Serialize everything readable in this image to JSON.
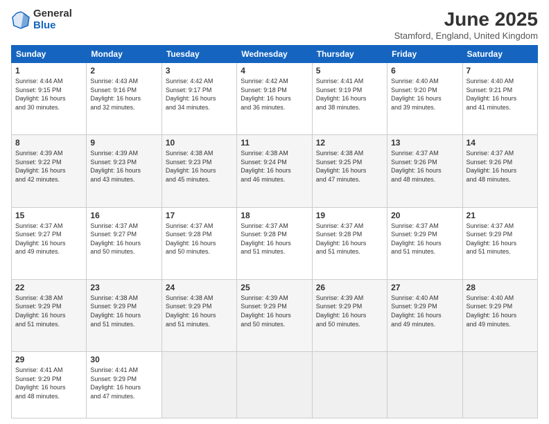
{
  "logo": {
    "general": "General",
    "blue": "Blue"
  },
  "title": "June 2025",
  "subtitle": "Stamford, England, United Kingdom",
  "days_header": [
    "Sunday",
    "Monday",
    "Tuesday",
    "Wednesday",
    "Thursday",
    "Friday",
    "Saturday"
  ],
  "weeks": [
    [
      {
        "num": "1",
        "info": "Sunrise: 4:44 AM\nSunset: 9:15 PM\nDaylight: 16 hours\nand 30 minutes."
      },
      {
        "num": "2",
        "info": "Sunrise: 4:43 AM\nSunset: 9:16 PM\nDaylight: 16 hours\nand 32 minutes."
      },
      {
        "num": "3",
        "info": "Sunrise: 4:42 AM\nSunset: 9:17 PM\nDaylight: 16 hours\nand 34 minutes."
      },
      {
        "num": "4",
        "info": "Sunrise: 4:42 AM\nSunset: 9:18 PM\nDaylight: 16 hours\nand 36 minutes."
      },
      {
        "num": "5",
        "info": "Sunrise: 4:41 AM\nSunset: 9:19 PM\nDaylight: 16 hours\nand 38 minutes."
      },
      {
        "num": "6",
        "info": "Sunrise: 4:40 AM\nSunset: 9:20 PM\nDaylight: 16 hours\nand 39 minutes."
      },
      {
        "num": "7",
        "info": "Sunrise: 4:40 AM\nSunset: 9:21 PM\nDaylight: 16 hours\nand 41 minutes."
      }
    ],
    [
      {
        "num": "8",
        "info": "Sunrise: 4:39 AM\nSunset: 9:22 PM\nDaylight: 16 hours\nand 42 minutes."
      },
      {
        "num": "9",
        "info": "Sunrise: 4:39 AM\nSunset: 9:23 PM\nDaylight: 16 hours\nand 43 minutes."
      },
      {
        "num": "10",
        "info": "Sunrise: 4:38 AM\nSunset: 9:23 PM\nDaylight: 16 hours\nand 45 minutes."
      },
      {
        "num": "11",
        "info": "Sunrise: 4:38 AM\nSunset: 9:24 PM\nDaylight: 16 hours\nand 46 minutes."
      },
      {
        "num": "12",
        "info": "Sunrise: 4:38 AM\nSunset: 9:25 PM\nDaylight: 16 hours\nand 47 minutes."
      },
      {
        "num": "13",
        "info": "Sunrise: 4:37 AM\nSunset: 9:26 PM\nDaylight: 16 hours\nand 48 minutes."
      },
      {
        "num": "14",
        "info": "Sunrise: 4:37 AM\nSunset: 9:26 PM\nDaylight: 16 hours\nand 48 minutes."
      }
    ],
    [
      {
        "num": "15",
        "info": "Sunrise: 4:37 AM\nSunset: 9:27 PM\nDaylight: 16 hours\nand 49 minutes."
      },
      {
        "num": "16",
        "info": "Sunrise: 4:37 AM\nSunset: 9:27 PM\nDaylight: 16 hours\nand 50 minutes."
      },
      {
        "num": "17",
        "info": "Sunrise: 4:37 AM\nSunset: 9:28 PM\nDaylight: 16 hours\nand 50 minutes."
      },
      {
        "num": "18",
        "info": "Sunrise: 4:37 AM\nSunset: 9:28 PM\nDaylight: 16 hours\nand 51 minutes."
      },
      {
        "num": "19",
        "info": "Sunrise: 4:37 AM\nSunset: 9:28 PM\nDaylight: 16 hours\nand 51 minutes."
      },
      {
        "num": "20",
        "info": "Sunrise: 4:37 AM\nSunset: 9:29 PM\nDaylight: 16 hours\nand 51 minutes."
      },
      {
        "num": "21",
        "info": "Sunrise: 4:37 AM\nSunset: 9:29 PM\nDaylight: 16 hours\nand 51 minutes."
      }
    ],
    [
      {
        "num": "22",
        "info": "Sunrise: 4:38 AM\nSunset: 9:29 PM\nDaylight: 16 hours\nand 51 minutes."
      },
      {
        "num": "23",
        "info": "Sunrise: 4:38 AM\nSunset: 9:29 PM\nDaylight: 16 hours\nand 51 minutes."
      },
      {
        "num": "24",
        "info": "Sunrise: 4:38 AM\nSunset: 9:29 PM\nDaylight: 16 hours\nand 51 minutes."
      },
      {
        "num": "25",
        "info": "Sunrise: 4:39 AM\nSunset: 9:29 PM\nDaylight: 16 hours\nand 50 minutes."
      },
      {
        "num": "26",
        "info": "Sunrise: 4:39 AM\nSunset: 9:29 PM\nDaylight: 16 hours\nand 50 minutes."
      },
      {
        "num": "27",
        "info": "Sunrise: 4:40 AM\nSunset: 9:29 PM\nDaylight: 16 hours\nand 49 minutes."
      },
      {
        "num": "28",
        "info": "Sunrise: 4:40 AM\nSunset: 9:29 PM\nDaylight: 16 hours\nand 49 minutes."
      }
    ],
    [
      {
        "num": "29",
        "info": "Sunrise: 4:41 AM\nSunset: 9:29 PM\nDaylight: 16 hours\nand 48 minutes."
      },
      {
        "num": "30",
        "info": "Sunrise: 4:41 AM\nSunset: 9:29 PM\nDaylight: 16 hours\nand 47 minutes."
      },
      {
        "num": "",
        "info": ""
      },
      {
        "num": "",
        "info": ""
      },
      {
        "num": "",
        "info": ""
      },
      {
        "num": "",
        "info": ""
      },
      {
        "num": "",
        "info": ""
      }
    ]
  ]
}
